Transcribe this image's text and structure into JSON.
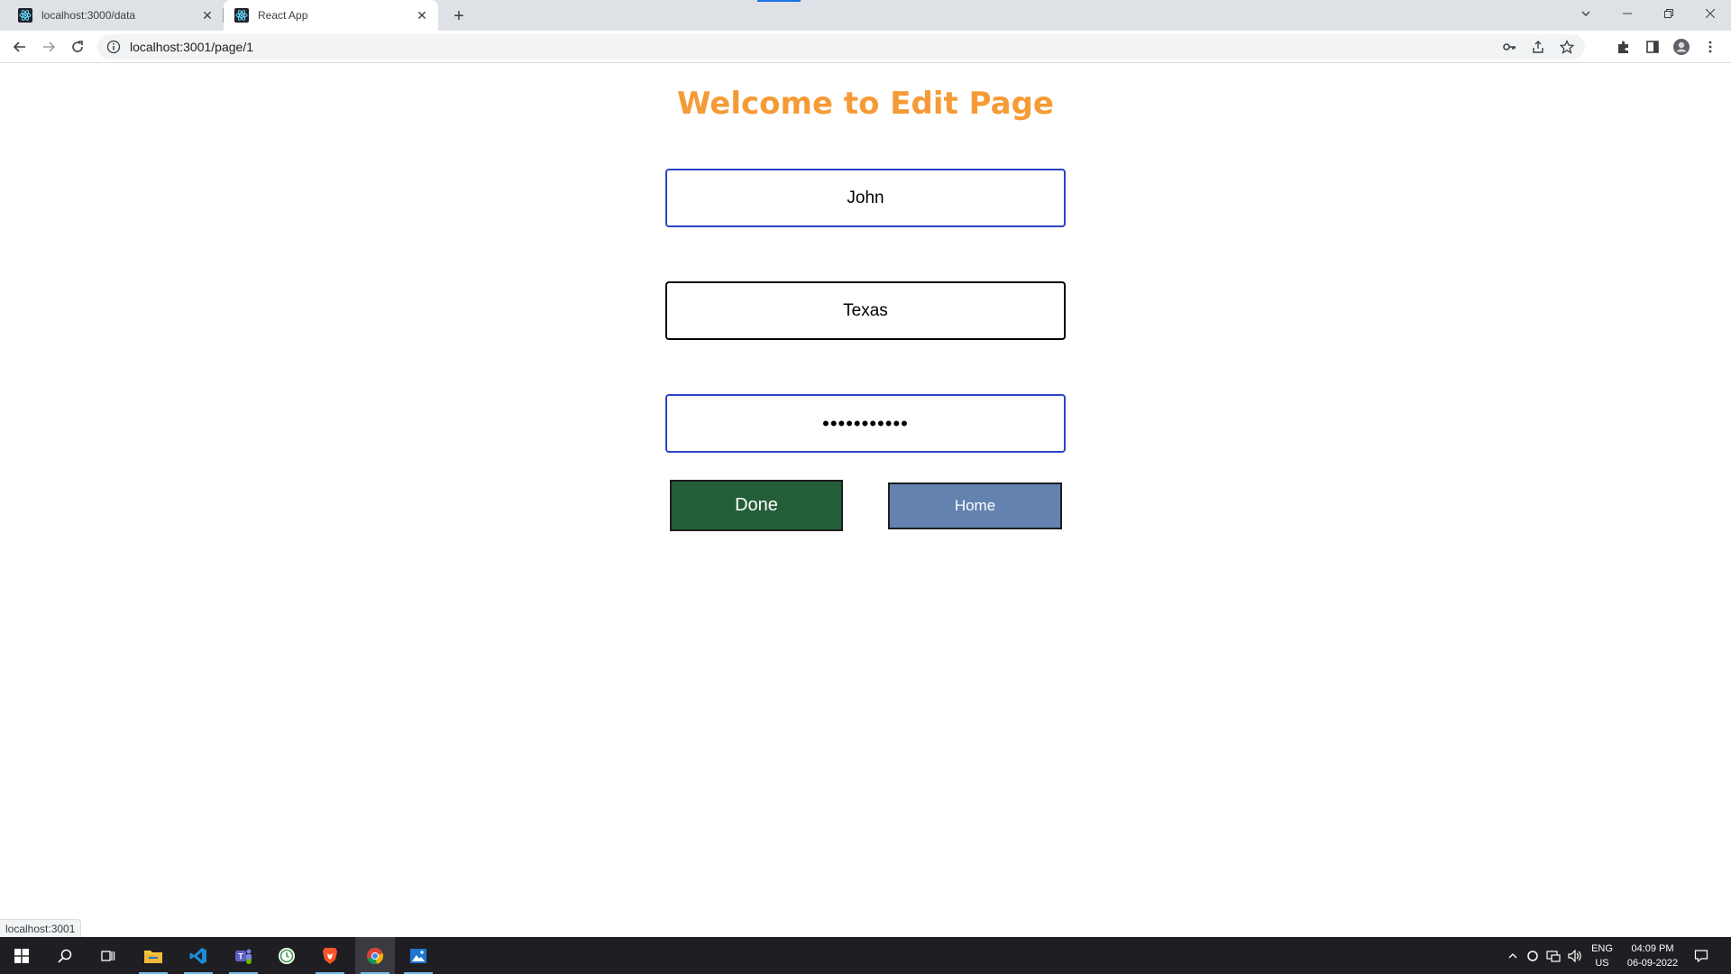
{
  "browser": {
    "tabs": [
      {
        "title": "localhost:3000/data",
        "active": false
      },
      {
        "title": "React App",
        "active": true
      }
    ],
    "url": "localhost:3001/page/1"
  },
  "page": {
    "title": "Welcome to Edit Page",
    "fields": [
      {
        "value": "John",
        "type": "text"
      },
      {
        "value": "Texas",
        "type": "text"
      },
      {
        "value": "12345678901",
        "type": "password"
      }
    ],
    "done_label": "Done",
    "home_label": "Home"
  },
  "status_bar": {
    "text": "localhost:3001"
  },
  "taskbar": {
    "language": "ENG",
    "region": "US",
    "time": "04:09 PM",
    "date": "06-09-2022"
  },
  "colors": {
    "title": "#f59b36",
    "done_button": "#245e38",
    "home_button": "#6382b0",
    "focus_border": "#2b44c8"
  }
}
